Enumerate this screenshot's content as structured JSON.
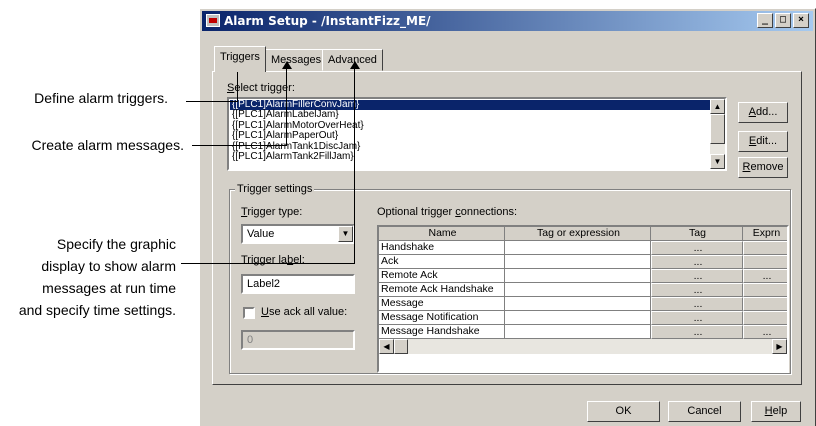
{
  "callouts": {
    "triggers": "Define alarm triggers.",
    "messages": "Create alarm messages.",
    "advanced_line1": "Specify the graphic",
    "advanced_line2": "display to  show alarm",
    "advanced_line3": "messages at run time",
    "advanced_line4": "and specify time settings."
  },
  "window": {
    "title": "Alarm Setup - /InstantFizz_ME/",
    "minimize": "_",
    "maximize": "□",
    "close": "×"
  },
  "tabs": [
    {
      "label": "Triggers",
      "active": true
    },
    {
      "label": "Messages",
      "active": false
    },
    {
      "label": "Advanced",
      "active": false
    }
  ],
  "select_trigger": {
    "label_pre": "",
    "label_u": "S",
    "label_post": "elect trigger:",
    "items": [
      "{[PLC1]AlarmFillerConvJam}",
      "{[PLC1]AlarmLabelJam}",
      "{[PLC1]AlarmMotorOverHeat}",
      "{[PLC1]AlarmPaperOut}",
      "{[PLC1]AlarmTank1DiscJam}",
      "{[PLC1]AlarmTank2FillJam}"
    ],
    "selected_index": 0
  },
  "side_buttons": {
    "add": {
      "u": "A",
      "rest": "dd..."
    },
    "edit": {
      "u": "E",
      "rest": "dit..."
    },
    "remove": {
      "u": "R",
      "rest": "emove"
    }
  },
  "trigger_settings": {
    "legend": "Trigger settings",
    "type_label": {
      "u": "T",
      "rest": "rigger type:"
    },
    "type_value": "Value",
    "label_label": {
      "pre": "Trigger la",
      "u": "b",
      "post": "el:"
    },
    "label_value": "Label2",
    "ack_all": {
      "u": "U",
      "rest": "se ack all value:"
    },
    "ack_value": "0"
  },
  "connections": {
    "label": {
      "pre": "Optional trigger ",
      "u": "c",
      "post": "onnections:"
    },
    "headers": [
      "Name",
      "Tag or expression",
      "Tag",
      "Exprn"
    ],
    "rows": [
      {
        "name": "Handshake",
        "tag": "...",
        "exprn": ""
      },
      {
        "name": "Ack",
        "tag": "...",
        "exprn": ""
      },
      {
        "name": "Remote Ack",
        "tag": "...",
        "exprn": "..."
      },
      {
        "name": "Remote Ack Handshake",
        "tag": "...",
        "exprn": ""
      },
      {
        "name": "Message",
        "tag": "...",
        "exprn": ""
      },
      {
        "name": "Message Notification",
        "tag": "...",
        "exprn": ""
      },
      {
        "name": "Message Handshake",
        "tag": "...",
        "exprn": "..."
      }
    ]
  },
  "footer": {
    "ok": "OK",
    "cancel": "Cancel",
    "help": {
      "u": "H",
      "rest": "elp"
    }
  }
}
